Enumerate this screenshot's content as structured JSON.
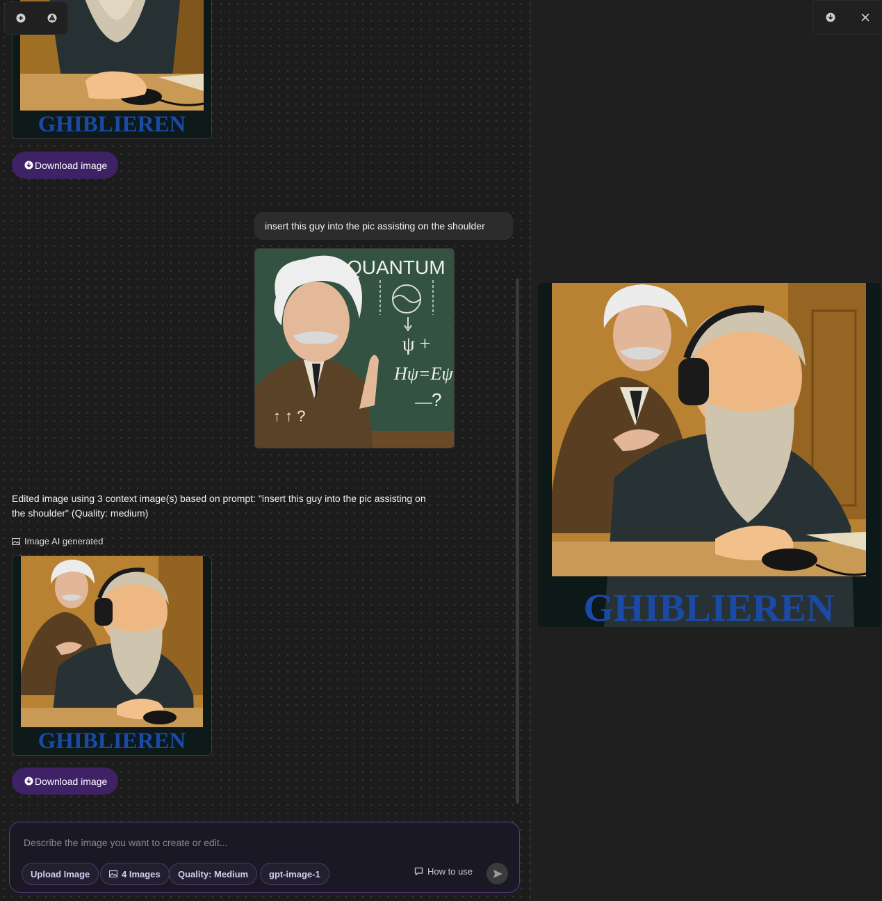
{
  "toolbar": {
    "new_icon": "plus-circle-icon",
    "brand_icon": "openai-logo-icon"
  },
  "messages": [
    {
      "role": "assistant",
      "image_text": "GHIBLIEREN",
      "download_label": "Download image"
    },
    {
      "role": "user",
      "text": "insert this guy into the pic assisting on the shoulder",
      "image_text": {
        "title": "QUANTUM",
        "psi": "ψ +",
        "eq": "Hψ=Eψ",
        "q": "?",
        "dots": "↑ ↑ ?"
      }
    },
    {
      "role": "assistant",
      "text": "Edited image using 3 context image(s) based on prompt: \"insert this guy into the pic assisting on the shoulder\" (Quality: medium)",
      "tag": "Image AI generated",
      "image_text": "GHIBLIEREN",
      "download_label": "Download image"
    }
  ],
  "composer": {
    "placeholder": "Describe the image you want to create or edit...",
    "upload_label": "Upload Image",
    "images_label": "4 Images",
    "quality_label": "Quality: Medium",
    "model_label": "gpt-image-1",
    "how_to_label": "How to use"
  },
  "preview": {
    "image_text": "GHIBLIEREN"
  },
  "colors": {
    "accent": "#3f2166",
    "composer_border": "#5a3a8e",
    "logo_text": "#1a4aa6"
  }
}
